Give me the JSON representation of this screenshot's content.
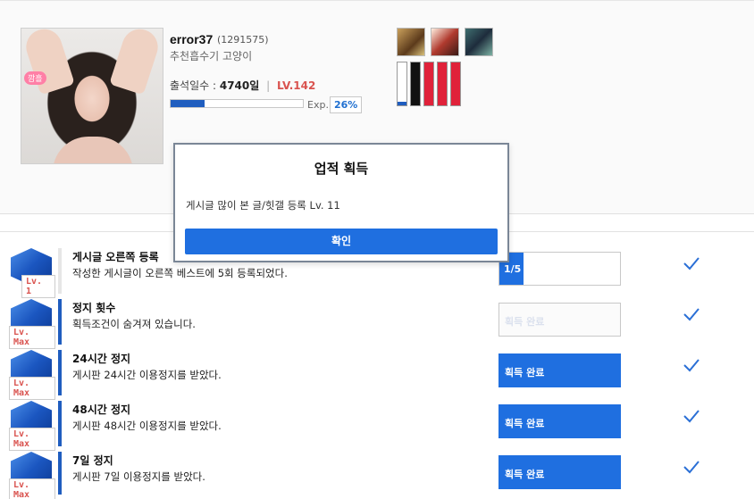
{
  "profile": {
    "avatar_badge": "깜흘",
    "username": "error37",
    "user_id": "(1291575)",
    "title": "추천흡수기 고양이",
    "attendance_label": "출석일수 :",
    "attendance_days": "4740일",
    "separator": "|",
    "level": "LV.142",
    "exp_label": "Exp.",
    "exp_percent": "26%",
    "exp_fraction": 0.26
  },
  "achievements": [
    {
      "level_tag": "Lv. 1",
      "title": "게시글 오른쪽 등록",
      "desc": "작성한 게시글이 오른쪽 베스트에 5회 등록되었다.",
      "status": "1/5",
      "progress": 0.2
    },
    {
      "level_tag": "Lv. Max",
      "title": "정지 횟수",
      "desc": "획득조건이 숨겨져 있습니다.",
      "status": "획득 완료"
    },
    {
      "level_tag": "Lv. Max",
      "title": "24시간 정지",
      "desc": "게시판 24시간 이용정지를 받았다.",
      "status": "획득 완료"
    },
    {
      "level_tag": "Lv. Max",
      "title": "48시간 정지",
      "desc": "게시판 48시간 이용정지를 받았다.",
      "status": "획득 완료"
    },
    {
      "level_tag": "Lv. Max",
      "title": "7일 정지",
      "desc": "게시판 7일 이용정지를 받았다.",
      "status": "획득 완료"
    }
  ],
  "modal": {
    "title": "업적 획득",
    "message": "게시글 많이 본 글/힛갤 등록 Lv. 11",
    "confirm_label": "확인"
  },
  "colors": {
    "accent": "#1f6fe0",
    "level_red": "#d9534f",
    "pillar_red": "#e0223a"
  }
}
